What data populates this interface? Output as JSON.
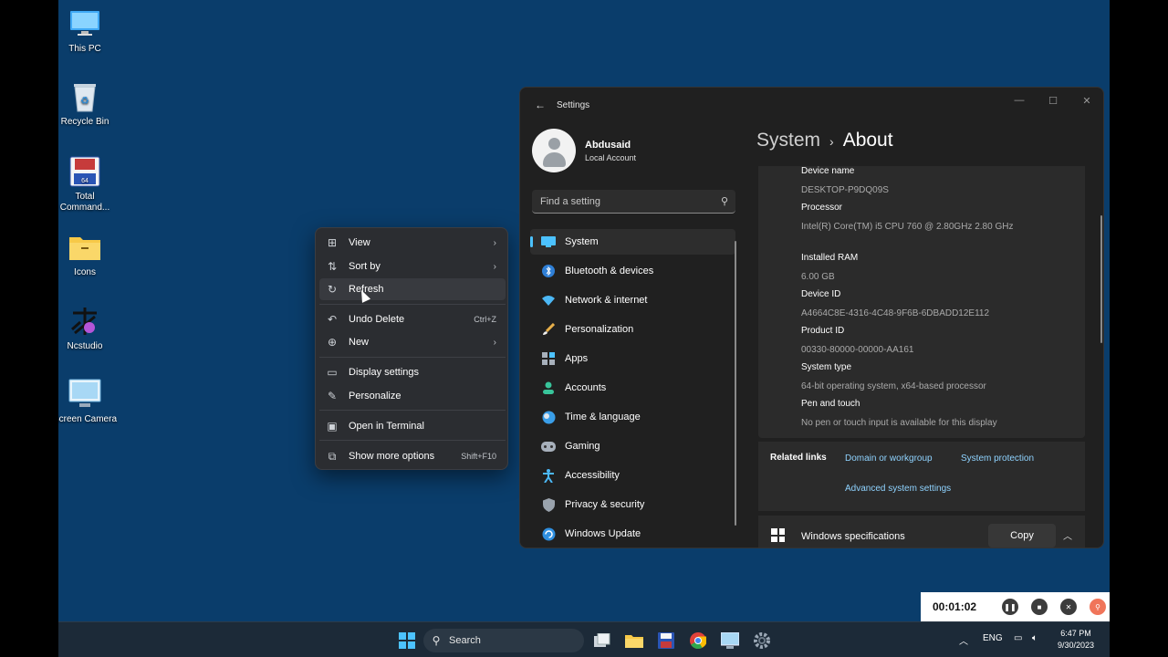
{
  "desktop": {
    "icons": [
      {
        "label": "This PC"
      },
      {
        "label": "Recycle Bin"
      },
      {
        "label": "Total Command..."
      },
      {
        "label": "Icons"
      },
      {
        "label": "Ncstudio"
      },
      {
        "label": "Screen Camera"
      }
    ]
  },
  "context_menu": {
    "items": [
      {
        "label": "View"
      },
      {
        "label": "Sort by"
      },
      {
        "label": "Refresh"
      },
      {
        "label": "Undo Delete",
        "shortcut": "Ctrl+Z"
      },
      {
        "label": "New"
      },
      {
        "label": "Display settings"
      },
      {
        "label": "Personalize"
      },
      {
        "label": "Open in Terminal"
      },
      {
        "label": "Show more options",
        "shortcut": "Shift+F10"
      }
    ]
  },
  "settings": {
    "window_title": "Settings",
    "user": {
      "name": "Abdusaid",
      "account_type": "Local Account"
    },
    "search_placeholder": "Find a setting",
    "nav": [
      {
        "label": "System",
        "icon": "monitor-icon",
        "active": true
      },
      {
        "label": "Bluetooth & devices",
        "icon": "bluetooth-icon"
      },
      {
        "label": "Network & internet",
        "icon": "wifi-icon"
      },
      {
        "label": "Personalization",
        "icon": "brush-icon"
      },
      {
        "label": "Apps",
        "icon": "apps-icon"
      },
      {
        "label": "Accounts",
        "icon": "person-icon"
      },
      {
        "label": "Time & language",
        "icon": "globe-clock-icon"
      },
      {
        "label": "Gaming",
        "icon": "gamepad-icon"
      },
      {
        "label": "Accessibility",
        "icon": "accessibility-icon"
      },
      {
        "label": "Privacy & security",
        "icon": "shield-icon"
      },
      {
        "label": "Windows Update",
        "icon": "update-icon"
      }
    ],
    "breadcrumb": {
      "parent": "System",
      "separator": "›",
      "current": "About"
    },
    "specs": [
      {
        "key": "Device name",
        "value": "DESKTOP-P9DQ09S"
      },
      {
        "key": "Processor",
        "value": "Intel(R) Core(TM) i5 CPU        760  @ 2.80GHz   2.80 GHz"
      },
      {
        "key": "Installed RAM",
        "value": "6.00 GB"
      },
      {
        "key": "Device ID",
        "value": "A4664C8E-4316-4C48-9F6B-6DBADD12E112"
      },
      {
        "key": "Product ID",
        "value": "00330-80000-00000-AA161"
      },
      {
        "key": "System type",
        "value": "64-bit operating system, x64-based processor"
      },
      {
        "key": "Pen and touch",
        "value": "No pen or touch input is available for this display"
      }
    ],
    "related_links": {
      "header": "Related links",
      "links": [
        "Domain or workgroup",
        "System protection",
        "Advanced system settings"
      ]
    },
    "windows_spec": {
      "label": "Windows specifications",
      "copy_label": "Copy"
    }
  },
  "recorder": {
    "time": "00:01:02"
  },
  "taskbar": {
    "search_label": "Search",
    "language": "ENG",
    "time": "6:47 PM",
    "date": "9/30/2023"
  },
  "colors": {
    "accent": "#4cc2ff",
    "link": "#8fd3ff",
    "desktop": "#0a3d6b"
  }
}
